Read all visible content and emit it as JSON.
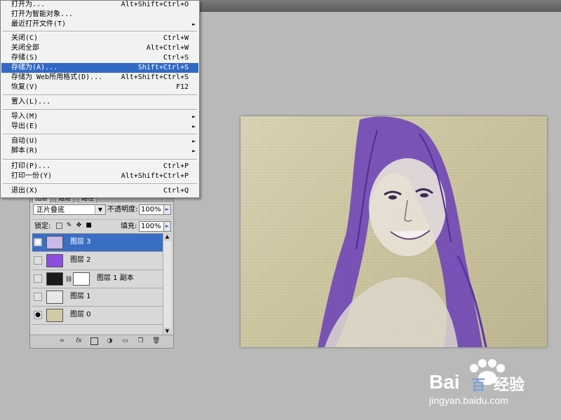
{
  "menu": {
    "items": [
      {
        "label": "打开为...",
        "shortcut": "Alt+Shift+Ctrl+O"
      },
      {
        "label": "打开为智能对象...",
        "shortcut": ""
      },
      {
        "label": "最近打开文件(T)",
        "shortcut": "",
        "submenu": "►"
      },
      {
        "label": "关闭(C)",
        "shortcut": "Ctrl+W"
      },
      {
        "label": "关闭全部",
        "shortcut": "Alt+Ctrl+W"
      },
      {
        "label": "存储(S)",
        "shortcut": "Ctrl+S"
      },
      {
        "label": "存储为(A)...",
        "shortcut": "Shift+Ctrl+S",
        "highlighted": true
      },
      {
        "label": "存储为 Web所用格式(D)...",
        "shortcut": "Alt+Shift+Ctrl+S"
      },
      {
        "label": "恢复(V)",
        "shortcut": "F12"
      },
      {
        "label": "置入(L)...",
        "shortcut": ""
      },
      {
        "label": "导入(M)",
        "shortcut": "",
        "submenu": "►"
      },
      {
        "label": "导出(E)",
        "shortcut": "",
        "submenu": "►"
      },
      {
        "label": "自动(U)",
        "shortcut": "",
        "submenu": "►"
      },
      {
        "label": "脚本(R)",
        "shortcut": "",
        "submenu": "►"
      },
      {
        "label": "打印(P)...",
        "shortcut": "Ctrl+P"
      },
      {
        "label": "打印一份(Y)",
        "shortcut": "Alt+Shift+Ctrl+P"
      },
      {
        "label": "退出(X)",
        "shortcut": "Ctrl+Q"
      }
    ]
  },
  "layers_panel": {
    "tabs": [
      "图层",
      "通道",
      "路径"
    ],
    "blend_mode": "正片叠底",
    "blend_dropdown_icon": "chevron-down-icon",
    "opacity_label": "不透明度:",
    "opacity_value": "100%",
    "lock_label": "锁定:",
    "fill_label": "填充:",
    "fill_value": "100%",
    "layers": [
      {
        "name": "图层 3",
        "visible": true,
        "selected": true,
        "thumb": "#c9b8e8"
      },
      {
        "name": "图层 2",
        "visible": false,
        "selected": false,
        "thumb": "#8a4fe0"
      },
      {
        "name": "图层 1 副本",
        "visible": false,
        "selected": false,
        "thumb": "#1a1a1a",
        "mask": true
      },
      {
        "name": "图层 1",
        "visible": false,
        "selected": false,
        "thumb": "#e8e8e8"
      },
      {
        "name": "图层 0",
        "visible": true,
        "selected": false,
        "thumb": "#d2c9a6"
      }
    ],
    "footer_icons": [
      "link-icon",
      "fx-icon",
      "mask-icon",
      "adjustment-icon",
      "folder-icon",
      "new-layer-icon",
      "trash-icon"
    ]
  },
  "watermark": {
    "brand": "Bai",
    "brand2": "百",
    "suffix": "经验",
    "url": "jingyan.baidu.com"
  },
  "colors": {
    "highlight": "#316ac5",
    "purple": "#6a40b8",
    "canvas_bg": "#cfc8a5"
  }
}
